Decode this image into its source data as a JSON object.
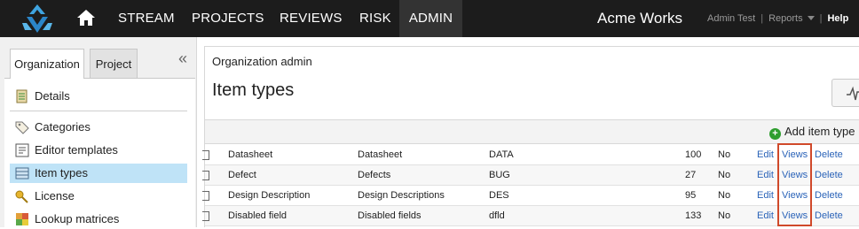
{
  "nav": {
    "items": [
      "STREAM",
      "PROJECTS",
      "REVIEWS",
      "RISK",
      "ADMIN"
    ],
    "active": "ADMIN",
    "brand": "Acme Works",
    "user": "Admin Test",
    "reports": "Reports",
    "help": "Help",
    "separator": "|"
  },
  "sidebar": {
    "tabs": [
      "Organization",
      "Project"
    ],
    "collapse": "«",
    "items": [
      {
        "label": "Details",
        "icon": "details-icon"
      },
      {
        "label": "Categories",
        "icon": "tag-icon"
      },
      {
        "label": "Editor templates",
        "icon": "template-icon"
      },
      {
        "label": "Item types",
        "icon": "item-types-icon"
      },
      {
        "label": "License",
        "icon": "key-icon"
      },
      {
        "label": "Lookup matrices",
        "icon": "matrix-icon"
      }
    ],
    "selected": "Item types"
  },
  "main": {
    "breadcrumb": "Organization admin",
    "title": "Item types",
    "add_label": "Add item type",
    "rows": [
      {
        "name": "Datasheet",
        "plural": "Datasheet",
        "key": "DATA",
        "count": "100",
        "flag": "No",
        "edit": "Edit",
        "views": "Views",
        "delete": "Delete"
      },
      {
        "name": "Defect",
        "plural": "Defects",
        "key": "BUG",
        "count": "27",
        "flag": "No",
        "edit": "Edit",
        "views": "Views",
        "delete": "Delete"
      },
      {
        "name": "Design Description",
        "plural": "Design Descriptions",
        "key": "DES",
        "count": "95",
        "flag": "No",
        "edit": "Edit",
        "views": "Views",
        "delete": "Delete"
      },
      {
        "name": "Disabled field",
        "plural": "Disabled fields",
        "key": "dfld",
        "count": "133",
        "flag": "No",
        "edit": "Edit",
        "views": "Views",
        "delete": "Delete"
      }
    ]
  },
  "colors": {
    "nav_bg": "#1c1c1c",
    "selected": "#bfe3f7",
    "link": "#2a63b8",
    "highlight": "#d0492a",
    "add": "#2e9e2e"
  }
}
